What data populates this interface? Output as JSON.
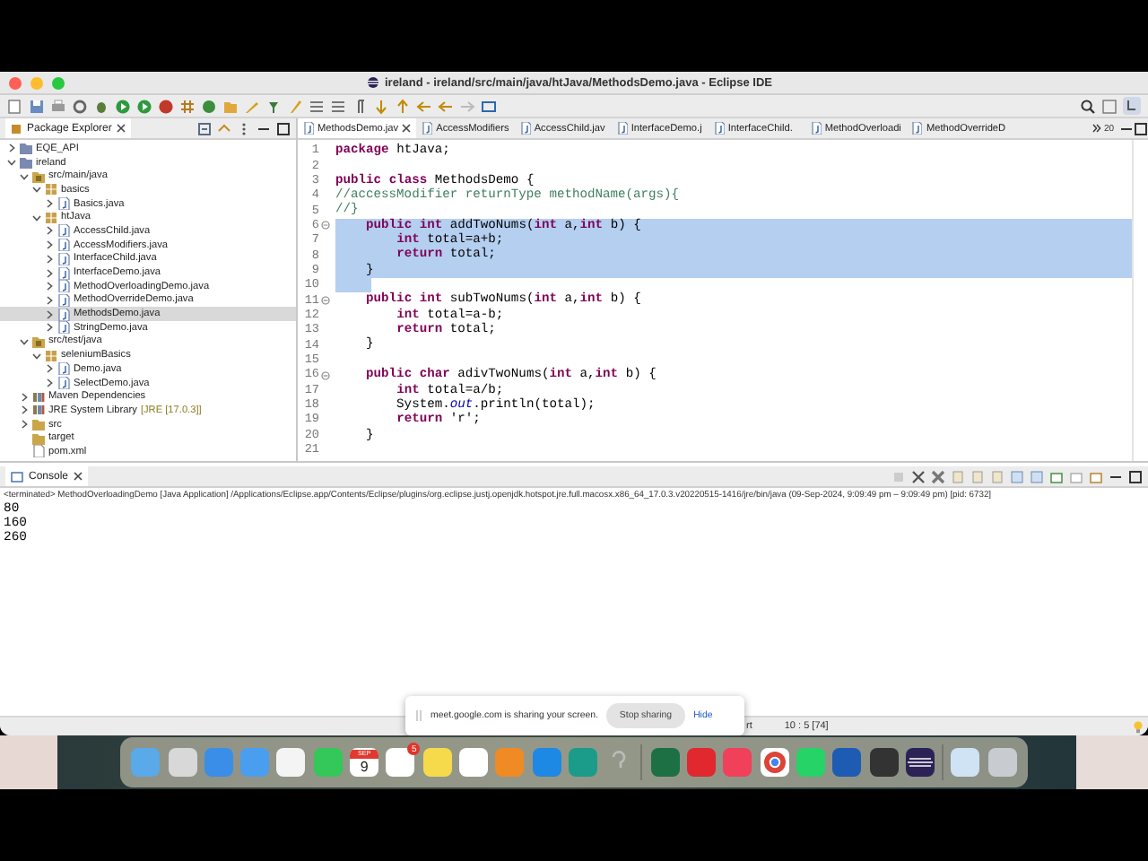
{
  "window": {
    "title": "ireland - ireland/src/main/java/htJava/MethodsDemo.java - Eclipse IDE"
  },
  "explorer": {
    "title": "Package Explorer",
    "items": [
      {
        "label": "EQE_API",
        "kind": "project",
        "expanded": false,
        "selected": false
      },
      {
        "label": "ireland",
        "kind": "project",
        "expanded": true,
        "selected": false,
        "children": [
          {
            "label": "src/main/java",
            "kind": "source",
            "expanded": true,
            "selected": false,
            "children": [
              {
                "label": "basics",
                "kind": "package",
                "expanded": true,
                "selected": false,
                "children": [
                  {
                    "label": "Basics.java",
                    "kind": "java",
                    "expanded": false,
                    "selected": false
                  }
                ]
              },
              {
                "label": "htJava",
                "kind": "package",
                "expanded": true,
                "selected": false,
                "children": [
                  {
                    "label": "AccessChild.java",
                    "kind": "java",
                    "expanded": false,
                    "selected": false
                  },
                  {
                    "label": "AccessModifiers.java",
                    "kind": "java",
                    "expanded": false,
                    "selected": false
                  },
                  {
                    "label": "InterfaceChild.java",
                    "kind": "java",
                    "expanded": false,
                    "selected": false
                  },
                  {
                    "label": "InterfaceDemo.java",
                    "kind": "java",
                    "expanded": false,
                    "selected": false
                  },
                  {
                    "label": "MethodOverloadingDemo.java",
                    "kind": "java",
                    "expanded": false,
                    "selected": false
                  },
                  {
                    "label": "MethodOverrideDemo.java",
                    "kind": "java",
                    "expanded": false,
                    "selected": false
                  },
                  {
                    "label": "MethodsDemo.java",
                    "kind": "java",
                    "expanded": false,
                    "selected": true
                  },
                  {
                    "label": "StringDemo.java",
                    "kind": "java",
                    "expanded": false,
                    "selected": false
                  }
                ]
              }
            ]
          },
          {
            "label": "src/test/java",
            "kind": "source",
            "expanded": true,
            "selected": false,
            "children": [
              {
                "label": "seleniumBasics",
                "kind": "package",
                "expanded": true,
                "selected": false,
                "children": [
                  {
                    "label": "Demo.java",
                    "kind": "java",
                    "expanded": false,
                    "selected": false
                  },
                  {
                    "label": "SelectDemo.java",
                    "kind": "java",
                    "expanded": false,
                    "selected": false
                  }
                ]
              }
            ]
          },
          {
            "label": "Maven Dependencies",
            "kind": "library",
            "expanded": false,
            "selected": false
          },
          {
            "label": "JRE System Library",
            "note": "[JRE [17.0.3]]",
            "kind": "library",
            "expanded": false,
            "selected": false
          },
          {
            "label": "src",
            "kind": "folder",
            "expanded": false,
            "selected": false
          },
          {
            "label": "target",
            "kind": "folder",
            "selected": false
          },
          {
            "label": "pom.xml",
            "kind": "file",
            "selected": false
          }
        ]
      }
    ]
  },
  "editor": {
    "tabs": [
      {
        "label": "MethodsDemo.jav",
        "selected": true
      },
      {
        "label": "AccessModifiers",
        "selected": false
      },
      {
        "label": "AccessChild.jav",
        "selected": false
      },
      {
        "label": "InterfaceDemo.j",
        "selected": false
      },
      {
        "label": "InterfaceChild.",
        "selected": false
      },
      {
        "label": "MethodOverloadi",
        "selected": false
      },
      {
        "label": "MethodOverrideD",
        "selected": false
      }
    ],
    "overflow_count": "20",
    "lines": [
      {
        "n": "1",
        "kind": "code",
        "code": "**package** htJava;",
        "fold": false,
        "selected": false
      },
      {
        "n": "2",
        "fold": false,
        "selected": false
      },
      {
        "n": "3",
        "kind": "code",
        "code": "**public** **class** MethodsDemo {",
        "fold": false,
        "selected": false
      },
      {
        "n": "4",
        "kind": "comment",
        "code": "//accessModifier returnType methodName(args){",
        "fold": false,
        "selected": false
      },
      {
        "n": "5",
        "kind": "comment",
        "code": "//}",
        "fold": false,
        "selected": false
      },
      {
        "n": "6",
        "kind": "code",
        "code": "    **public** **int** addTwoNums(**int** a,**int** b) {",
        "fold": true,
        "selected": true
      },
      {
        "n": "7",
        "kind": "code",
        "code": "        **int** total=a+b;",
        "fold": false,
        "selected": true
      },
      {
        "n": "8",
        "kind": "code",
        "code": "        **return** total;",
        "fold": false,
        "selected": true
      },
      {
        "n": "9",
        "kind": "code",
        "code": "    }",
        "fold": false,
        "selected": true
      },
      {
        "n": "10",
        "fold": false,
        "selected": true
      },
      {
        "n": "11",
        "kind": "code",
        "code": "    **public** **int** subTwoNums(**int** a,**int** b) {",
        "fold": true,
        "selected": false
      },
      {
        "n": "12",
        "kind": "code",
        "code": "        **int** total=a-b;",
        "fold": false,
        "selected": false
      },
      {
        "n": "13",
        "kind": "code",
        "code": "        **return** total;",
        "fold": false,
        "selected": false
      },
      {
        "n": "14",
        "kind": "code",
        "code": "    }",
        "fold": false,
        "selected": false
      },
      {
        "n": "15",
        "fold": false,
        "selected": false
      },
      {
        "n": "16",
        "kind": "code",
        "code": "    **public** **char** adivTwoNums(**int** a,**int** b) {",
        "fold": true,
        "selected": false
      },
      {
        "n": "17",
        "kind": "code",
        "code": "        **int** total=a/b;",
        "fold": false,
        "selected": false
      },
      {
        "n": "18",
        "kind": "code",
        "code": "        System.*out*.println(total);",
        "fold": false,
        "selected": false
      },
      {
        "n": "19",
        "kind": "code",
        "code": "        **return** 'r';",
        "fold": false,
        "selected": false
      },
      {
        "n": "20",
        "kind": "code",
        "code": "    }",
        "fold": false,
        "selected": false
      },
      {
        "n": "21",
        "fold": false,
        "selected": false
      }
    ]
  },
  "console": {
    "title": "Console",
    "info": "<terminated> MethodOverloadingDemo [Java Application] /Applications/Eclipse.app/Contents/Eclipse/plugins/org.eclipse.justj.openjdk.hotspot.jre.full.macosx.x86_64_17.0.3.v20220515-1416/jre/bin/java  (09-Sep-2024, 9:09:49 pm – 9:09:49 pm) [pid: 6732]",
    "output": [
      "80",
      "160",
      "260"
    ]
  },
  "status_bar": {
    "insert_mode": "rt",
    "position": "10 : 5 [74]"
  },
  "share_notice": {
    "text": "meet.google.com is sharing your screen.",
    "stop_button": "Stop sharing",
    "hide_link": "Hide"
  },
  "dock": {
    "calendar_month": "SEP",
    "calendar_day": "9",
    "reminders_badge": "5"
  }
}
